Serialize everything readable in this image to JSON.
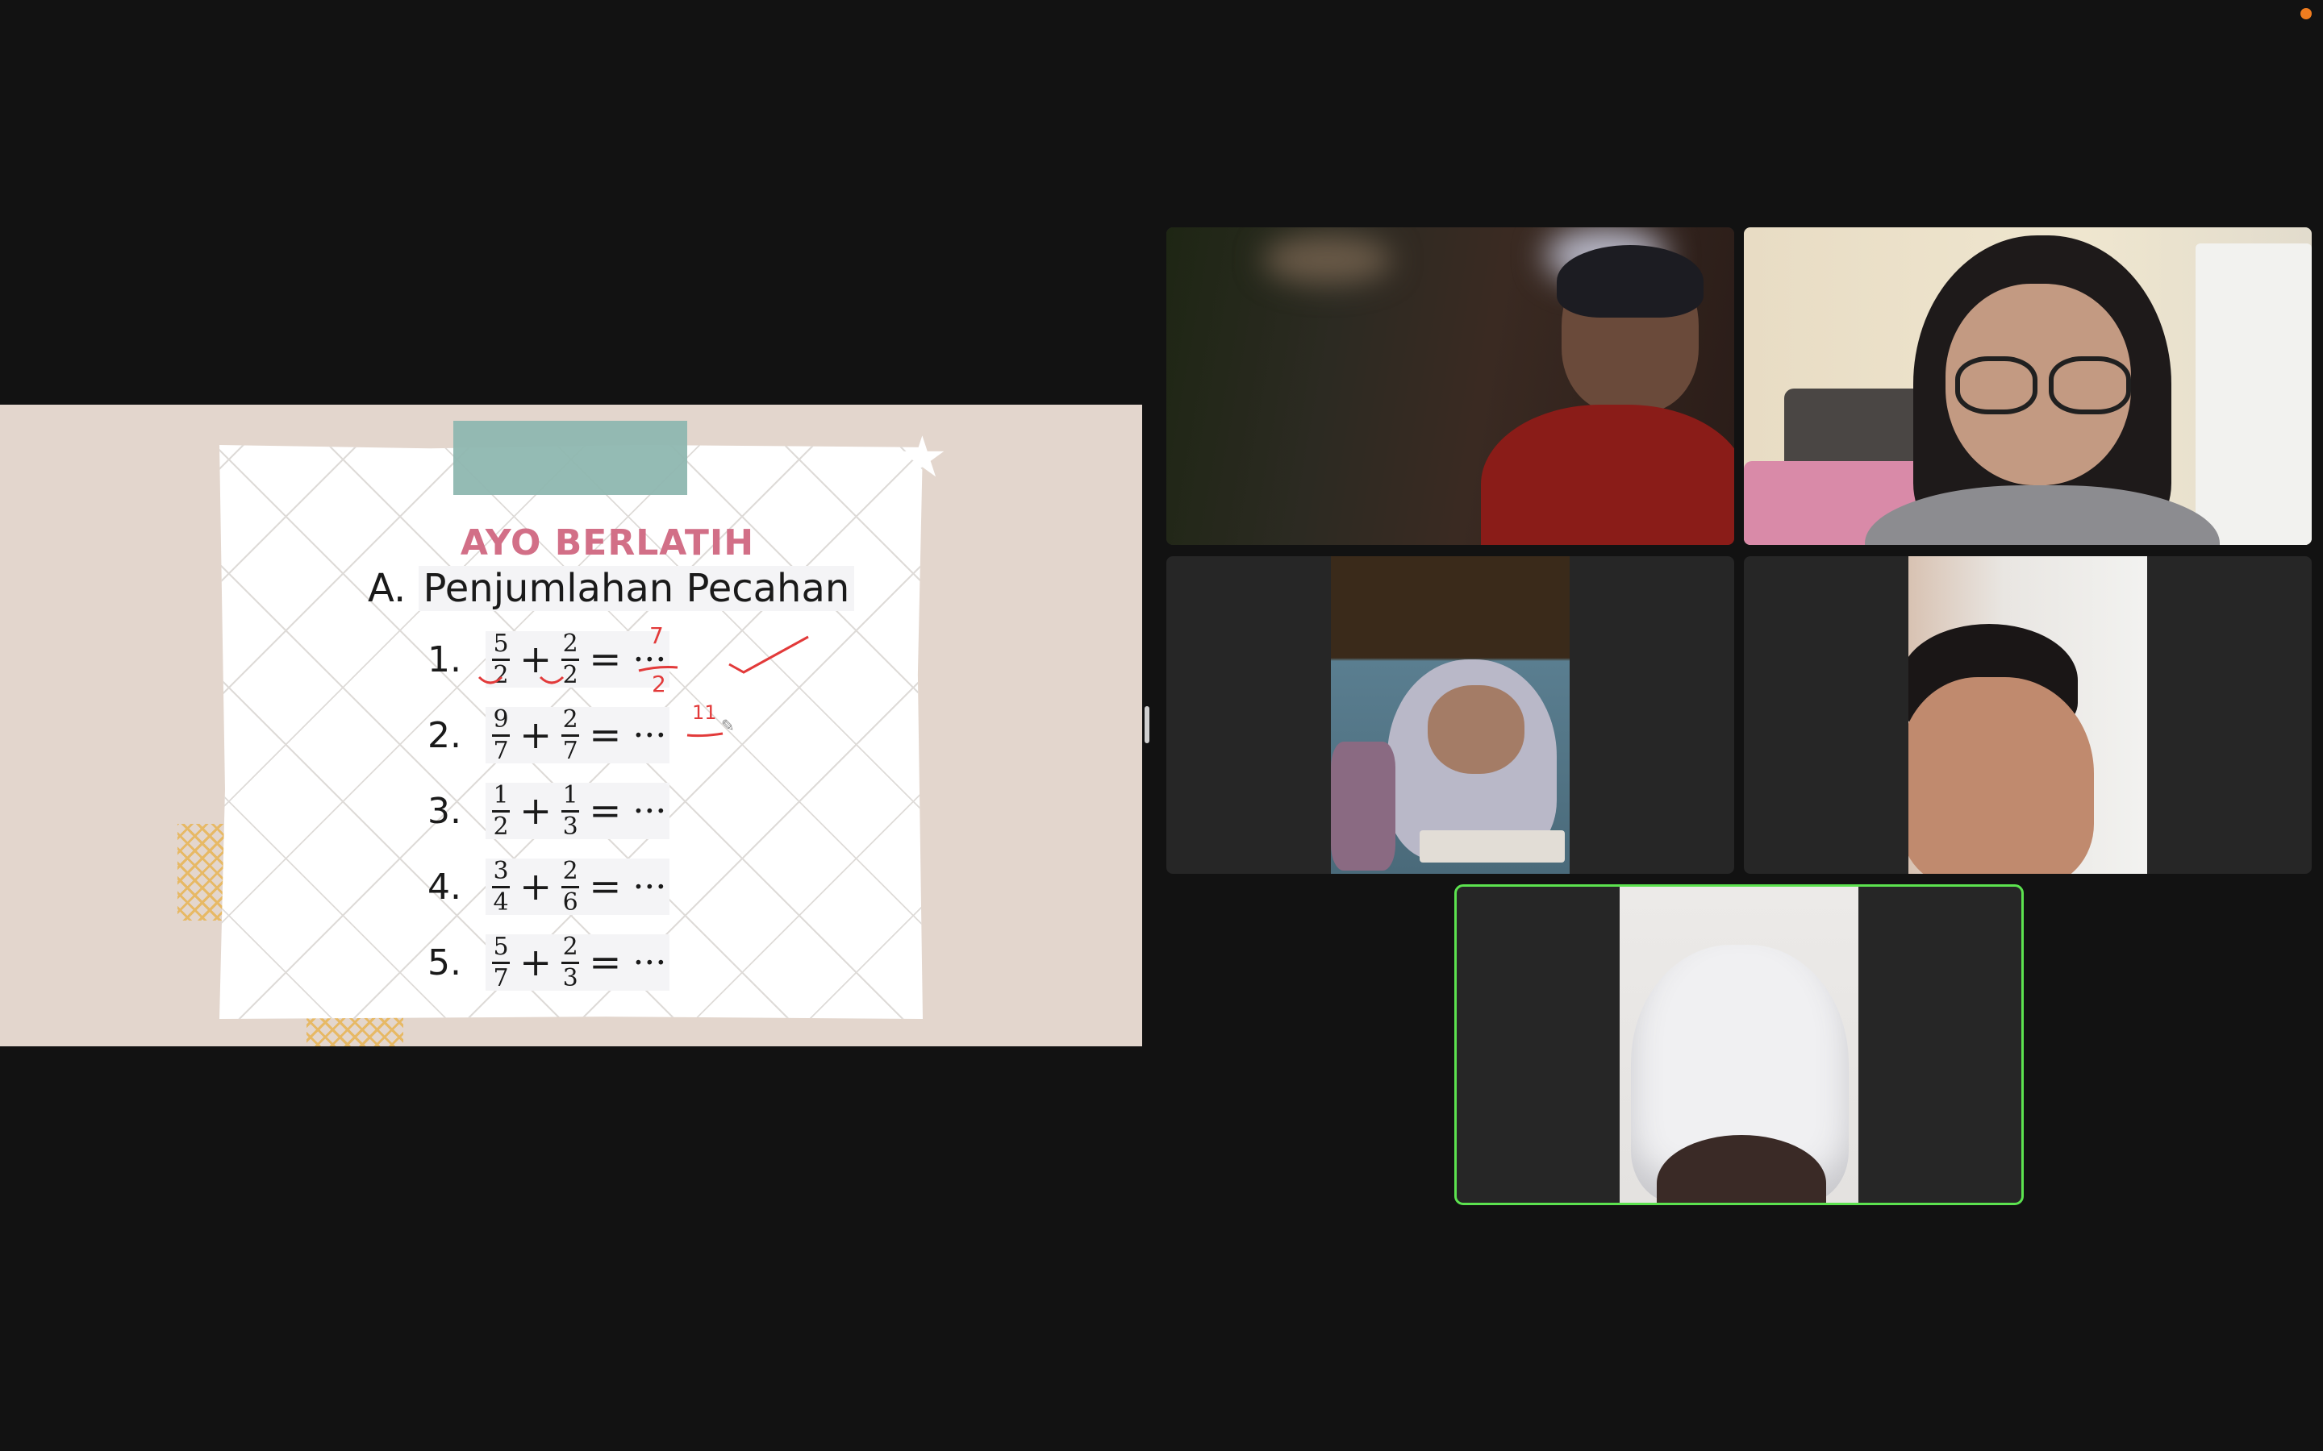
{
  "slide": {
    "title": "AYO BERLATIH !!!!!",
    "section": "A.",
    "subtitle": "Penjumlahan Pecahan",
    "problems": [
      {
        "no": "1.",
        "a_num": "5",
        "a_den": "2",
        "b_num": "2",
        "b_den": "2",
        "plus": "+",
        "equals": "=",
        "ellipsis": "···"
      },
      {
        "no": "2.",
        "a_num": "9",
        "a_den": "7",
        "b_num": "2",
        "b_den": "7",
        "plus": "+",
        "equals": "=",
        "ellipsis": "···"
      },
      {
        "no": "3.",
        "a_num": "1",
        "a_den": "2",
        "b_num": "1",
        "b_den": "3",
        "plus": "+",
        "equals": "=",
        "ellipsis": "···"
      },
      {
        "no": "4.",
        "a_num": "3",
        "a_den": "4",
        "b_num": "2",
        "b_den": "6",
        "plus": "+",
        "equals": "=",
        "ellipsis": "···"
      },
      {
        "no": "5.",
        "a_num": "5",
        "a_den": "7",
        "b_num": "2",
        "b_den": "3",
        "plus": "+",
        "equals": "=",
        "ellipsis": "···"
      }
    ],
    "annotation": {
      "answer1_num": "7",
      "answer1_den": "2",
      "answer2": "11"
    }
  },
  "participants": [
    {
      "id": "boy-red-shirt"
    },
    {
      "id": "teacher-glasses"
    },
    {
      "id": "girl-hijab-writing"
    },
    {
      "id": "boy-close-up"
    },
    {
      "id": "girl-white-hijab",
      "speaking": true
    }
  ],
  "colors": {
    "background": "#121212",
    "tile": "#262626",
    "active_speaker": "#5ce24f",
    "slide_title": "#d26f87",
    "annotation_ink": "#e23a3a",
    "recording": "#f07c1f"
  }
}
